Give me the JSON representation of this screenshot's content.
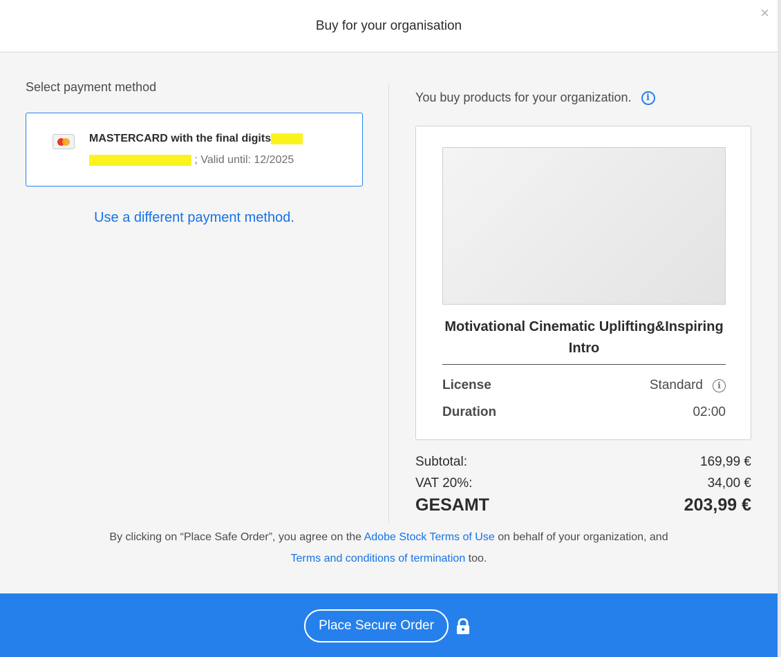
{
  "dialog": {
    "title": "Buy for your organisation",
    "close_glyph": "×"
  },
  "payment": {
    "section_label": "Select payment method",
    "card_icon": "mastercard-icon",
    "card_text_1": "MASTERCARD with the final digits",
    "card_valid": "; Valid until: 12/2025",
    "different_method_link": "Use a different payment method."
  },
  "order": {
    "org_notice": "You buy products for your organization.",
    "info_glyph": "i",
    "product_title": "Motivational Cinematic Uplifting&Inspiring Intro",
    "details": [
      {
        "label": "License",
        "value": "Standard"
      },
      {
        "label": "Duration",
        "value": "02:00"
      }
    ],
    "thumb_icon": "audio-waveform-icon"
  },
  "totals": {
    "subtotal_label": "Subtotal:",
    "subtotal_value": "169,99 €",
    "vat_label": "VAT 20%:",
    "vat_value": "34,00 €",
    "total_label": "GESAMT",
    "total_value": "203,99 €"
  },
  "terms": {
    "part1": "By clicking on “Place Safe Order”, you agree on the",
    "link1": "Adobe Stock Terms of Use",
    "part2": "on behalf of your organization, and",
    "link2": "Terms and conditions of termination",
    "part3": "too."
  },
  "footer": {
    "order_button": "Place Secure Order",
    "lock_icon": "lock-icon"
  },
  "colors": {
    "accent": "#2680eb",
    "link": "#1473e6",
    "redaction": "#fbf31d"
  }
}
